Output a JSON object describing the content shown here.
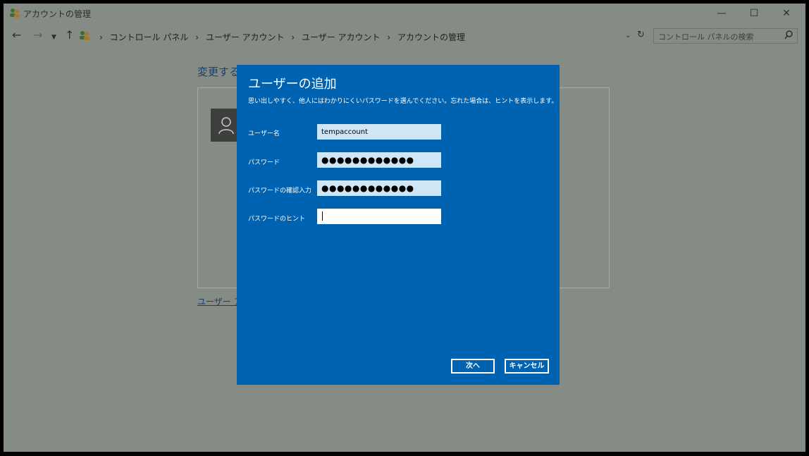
{
  "window": {
    "title": "アカウントの管理",
    "controls": {
      "minimize": "—",
      "maximize": "☐",
      "close": "✕"
    }
  },
  "address_bar": {
    "breadcrumb": [
      "コントロール パネル",
      "ユーザー アカウント",
      "ユーザー アカウント",
      "アカウントの管理"
    ],
    "search_placeholder": "コントロール パネルの検索"
  },
  "background_page": {
    "heading": "変更する",
    "link_text": "ユーザー アカ"
  },
  "dialog": {
    "title": "ユーザーの追加",
    "description": "思い出しやすく、他人にはわかりにくいパスワードを選んでください。忘れた場合は、ヒントを表示します。",
    "fields": {
      "username": {
        "label": "ユーザー名",
        "value": "tempaccount"
      },
      "password": {
        "label": "パスワード",
        "value": "●●●●●●●●●●●●"
      },
      "confirm": {
        "label": "パスワードの確認入力",
        "value": "●●●●●●●●●●●●"
      },
      "hint": {
        "label": "パスワードのヒント",
        "value": ""
      }
    },
    "buttons": {
      "next": "次へ",
      "cancel": "キャンセル"
    }
  },
  "colors": {
    "dialog_bg": "#0063b1",
    "window_bg": "#858c85",
    "input_bg": "#cfe6f7"
  }
}
